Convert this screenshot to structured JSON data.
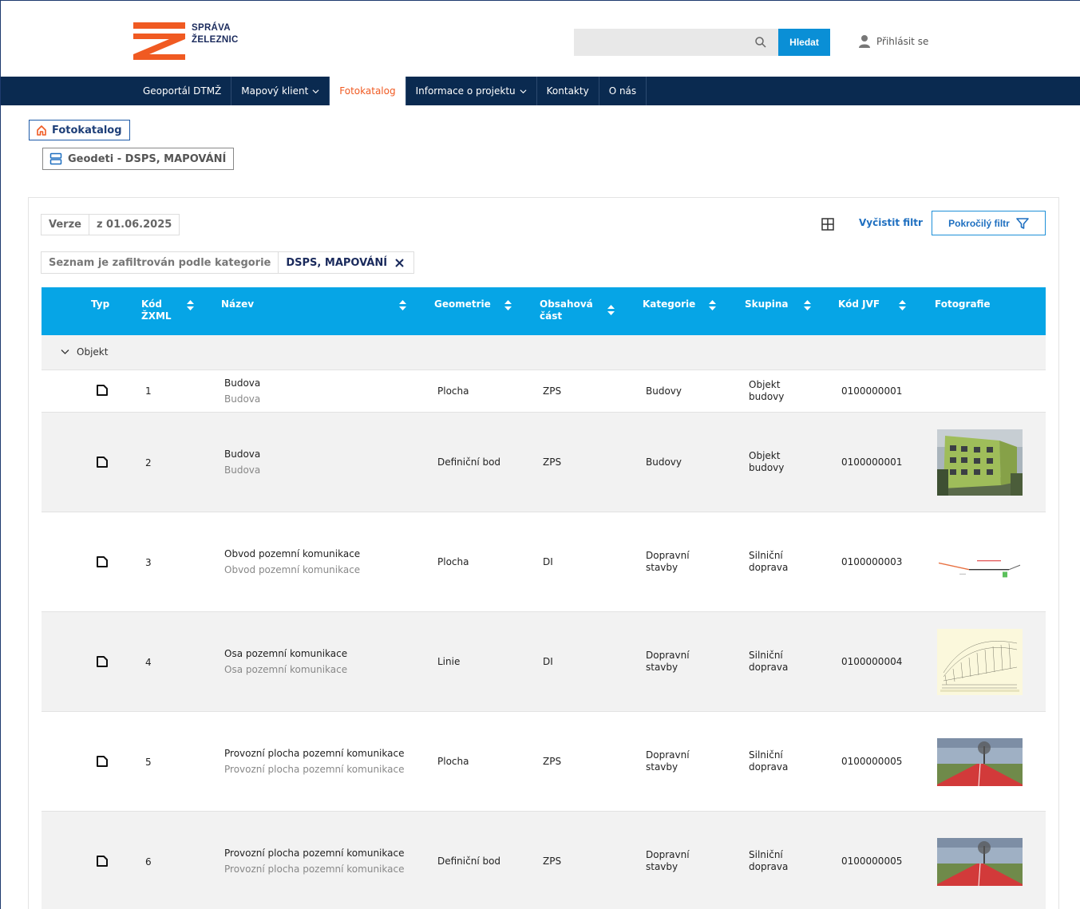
{
  "brand": {
    "line1": "SPRÁVA",
    "line2": "ŽELEZNIC",
    "color": "#f05a22",
    "navy": "#0a2a50",
    "accent": "#06a5e6"
  },
  "header": {
    "search_placeholder": "",
    "search_button": "Hledat",
    "login": "Přihlásit se"
  },
  "nav": {
    "items": [
      {
        "label": "Geoportál DTMŽ"
      },
      {
        "label": "Mapový klient",
        "dropdown": true
      },
      {
        "label": "Fotokatalog",
        "active": true
      },
      {
        "label": "Informace o projektu",
        "dropdown": true
      },
      {
        "label": "Kontakty"
      },
      {
        "label": "O nás"
      }
    ]
  },
  "breadcrumb": {
    "root": "Fotokatalog",
    "current": "Geodeti - DSPS, MAPOVÁNÍ"
  },
  "toolbar": {
    "version_label": "Verze",
    "version_value": "z 01.06.2025",
    "clear_filter": "Vyčistit filtr",
    "advanced_filter": "Pokročilý filtr",
    "filter_note": "Seznam je zafiltrován podle kategorie",
    "filter_value": "DSPS, MAPOVÁNÍ"
  },
  "table": {
    "headers": {
      "typ": "Typ",
      "kod_1": "Kód",
      "kod_2": "ŽXML",
      "nazev": "Název",
      "geometrie": "Geometrie",
      "obsah_1": "Obsahová",
      "obsah_2": "část",
      "kategorie": "Kategorie",
      "skupina": "Skupina",
      "kod_jvf": "Kód JVF",
      "fotografie": "Fotografie"
    },
    "group": "Objekt",
    "rows": [
      {
        "code": "1",
        "name": "Budova",
        "name_sub": "Budova",
        "geometry": "Plocha",
        "part": "ZPS",
        "cat_1": "Budovy",
        "cat_2": "",
        "grp_1": "Objekt",
        "grp_2": "budovy",
        "jvf": "0100000001",
        "photo": "none"
      },
      {
        "code": "2",
        "name": "Budova",
        "name_sub": "Budova",
        "geometry": "Definiční bod",
        "part": "ZPS",
        "cat_1": "Budovy",
        "cat_2": "",
        "grp_1": "Objekt",
        "grp_2": "budovy",
        "jvf": "0100000001",
        "photo": "building"
      },
      {
        "code": "3",
        "name": "Obvod pozemní komunikace",
        "name_sub": "Obvod pozemní komunikace",
        "geometry": "Plocha",
        "part": "DI",
        "cat_1": "Dopravní",
        "cat_2": "stavby",
        "grp_1": "Silniční",
        "grp_2": "doprava",
        "jvf": "0100000003",
        "photo": "profile"
      },
      {
        "code": "4",
        "name": "Osa pozemní komunikace",
        "name_sub": "Osa pozemní komunikace",
        "geometry": "Linie",
        "part": "DI",
        "cat_1": "Dopravní",
        "cat_2": "stavby",
        "grp_1": "Silniční",
        "grp_2": "doprava",
        "jvf": "0100000004",
        "photo": "sketch"
      },
      {
        "code": "5",
        "name": "Provozní plocha pozemní komunikace",
        "name_sub": "Provozní plocha pozemní komunikace",
        "geometry": "Plocha",
        "part": "ZPS",
        "cat_1": "Dopravní",
        "cat_2": "stavby",
        "grp_1": "Silniční",
        "grp_2": "doprava",
        "jvf": "0100000005",
        "photo": "road"
      },
      {
        "code": "6",
        "name": "Provozní plocha pozemní komunikace",
        "name_sub": "Provozní plocha pozemní komunikace",
        "geometry": "Definiční bod",
        "part": "ZPS",
        "cat_1": "Dopravní",
        "cat_2": "stavby",
        "grp_1": "Silniční",
        "grp_2": "doprava",
        "jvf": "0100000005",
        "photo": "road"
      }
    ]
  }
}
